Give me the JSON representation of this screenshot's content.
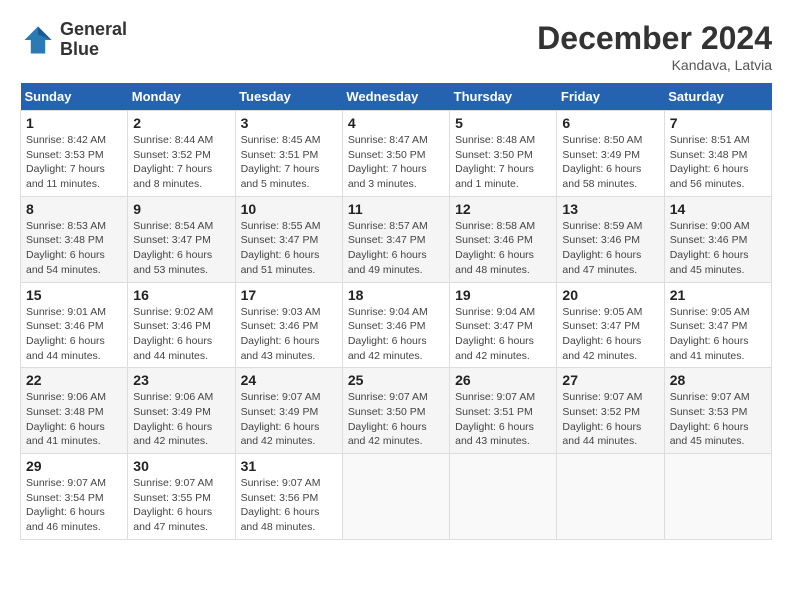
{
  "header": {
    "logo_line1": "General",
    "logo_line2": "Blue",
    "month": "December 2024",
    "location": "Kandava, Latvia"
  },
  "days_of_week": [
    "Sunday",
    "Monday",
    "Tuesday",
    "Wednesday",
    "Thursday",
    "Friday",
    "Saturday"
  ],
  "weeks": [
    [
      {
        "day": 1,
        "info": "Sunrise: 8:42 AM\nSunset: 3:53 PM\nDaylight: 7 hours\nand 11 minutes."
      },
      {
        "day": 2,
        "info": "Sunrise: 8:44 AM\nSunset: 3:52 PM\nDaylight: 7 hours\nand 8 minutes."
      },
      {
        "day": 3,
        "info": "Sunrise: 8:45 AM\nSunset: 3:51 PM\nDaylight: 7 hours\nand 5 minutes."
      },
      {
        "day": 4,
        "info": "Sunrise: 8:47 AM\nSunset: 3:50 PM\nDaylight: 7 hours\nand 3 minutes."
      },
      {
        "day": 5,
        "info": "Sunrise: 8:48 AM\nSunset: 3:50 PM\nDaylight: 7 hours\nand 1 minute."
      },
      {
        "day": 6,
        "info": "Sunrise: 8:50 AM\nSunset: 3:49 PM\nDaylight: 6 hours\nand 58 minutes."
      },
      {
        "day": 7,
        "info": "Sunrise: 8:51 AM\nSunset: 3:48 PM\nDaylight: 6 hours\nand 56 minutes."
      }
    ],
    [
      {
        "day": 8,
        "info": "Sunrise: 8:53 AM\nSunset: 3:48 PM\nDaylight: 6 hours\nand 54 minutes."
      },
      {
        "day": 9,
        "info": "Sunrise: 8:54 AM\nSunset: 3:47 PM\nDaylight: 6 hours\nand 53 minutes."
      },
      {
        "day": 10,
        "info": "Sunrise: 8:55 AM\nSunset: 3:47 PM\nDaylight: 6 hours\nand 51 minutes."
      },
      {
        "day": 11,
        "info": "Sunrise: 8:57 AM\nSunset: 3:47 PM\nDaylight: 6 hours\nand 49 minutes."
      },
      {
        "day": 12,
        "info": "Sunrise: 8:58 AM\nSunset: 3:46 PM\nDaylight: 6 hours\nand 48 minutes."
      },
      {
        "day": 13,
        "info": "Sunrise: 8:59 AM\nSunset: 3:46 PM\nDaylight: 6 hours\nand 47 minutes."
      },
      {
        "day": 14,
        "info": "Sunrise: 9:00 AM\nSunset: 3:46 PM\nDaylight: 6 hours\nand 45 minutes."
      }
    ],
    [
      {
        "day": 15,
        "info": "Sunrise: 9:01 AM\nSunset: 3:46 PM\nDaylight: 6 hours\nand 44 minutes."
      },
      {
        "day": 16,
        "info": "Sunrise: 9:02 AM\nSunset: 3:46 PM\nDaylight: 6 hours\nand 44 minutes."
      },
      {
        "day": 17,
        "info": "Sunrise: 9:03 AM\nSunset: 3:46 PM\nDaylight: 6 hours\nand 43 minutes."
      },
      {
        "day": 18,
        "info": "Sunrise: 9:04 AM\nSunset: 3:46 PM\nDaylight: 6 hours\nand 42 minutes."
      },
      {
        "day": 19,
        "info": "Sunrise: 9:04 AM\nSunset: 3:47 PM\nDaylight: 6 hours\nand 42 minutes."
      },
      {
        "day": 20,
        "info": "Sunrise: 9:05 AM\nSunset: 3:47 PM\nDaylight: 6 hours\nand 42 minutes."
      },
      {
        "day": 21,
        "info": "Sunrise: 9:05 AM\nSunset: 3:47 PM\nDaylight: 6 hours\nand 41 minutes."
      }
    ],
    [
      {
        "day": 22,
        "info": "Sunrise: 9:06 AM\nSunset: 3:48 PM\nDaylight: 6 hours\nand 41 minutes."
      },
      {
        "day": 23,
        "info": "Sunrise: 9:06 AM\nSunset: 3:49 PM\nDaylight: 6 hours\nand 42 minutes."
      },
      {
        "day": 24,
        "info": "Sunrise: 9:07 AM\nSunset: 3:49 PM\nDaylight: 6 hours\nand 42 minutes."
      },
      {
        "day": 25,
        "info": "Sunrise: 9:07 AM\nSunset: 3:50 PM\nDaylight: 6 hours\nand 42 minutes."
      },
      {
        "day": 26,
        "info": "Sunrise: 9:07 AM\nSunset: 3:51 PM\nDaylight: 6 hours\nand 43 minutes."
      },
      {
        "day": 27,
        "info": "Sunrise: 9:07 AM\nSunset: 3:52 PM\nDaylight: 6 hours\nand 44 minutes."
      },
      {
        "day": 28,
        "info": "Sunrise: 9:07 AM\nSunset: 3:53 PM\nDaylight: 6 hours\nand 45 minutes."
      }
    ],
    [
      {
        "day": 29,
        "info": "Sunrise: 9:07 AM\nSunset: 3:54 PM\nDaylight: 6 hours\nand 46 minutes."
      },
      {
        "day": 30,
        "info": "Sunrise: 9:07 AM\nSunset: 3:55 PM\nDaylight: 6 hours\nand 47 minutes."
      },
      {
        "day": 31,
        "info": "Sunrise: 9:07 AM\nSunset: 3:56 PM\nDaylight: 6 hours\nand 48 minutes."
      },
      null,
      null,
      null,
      null
    ]
  ]
}
